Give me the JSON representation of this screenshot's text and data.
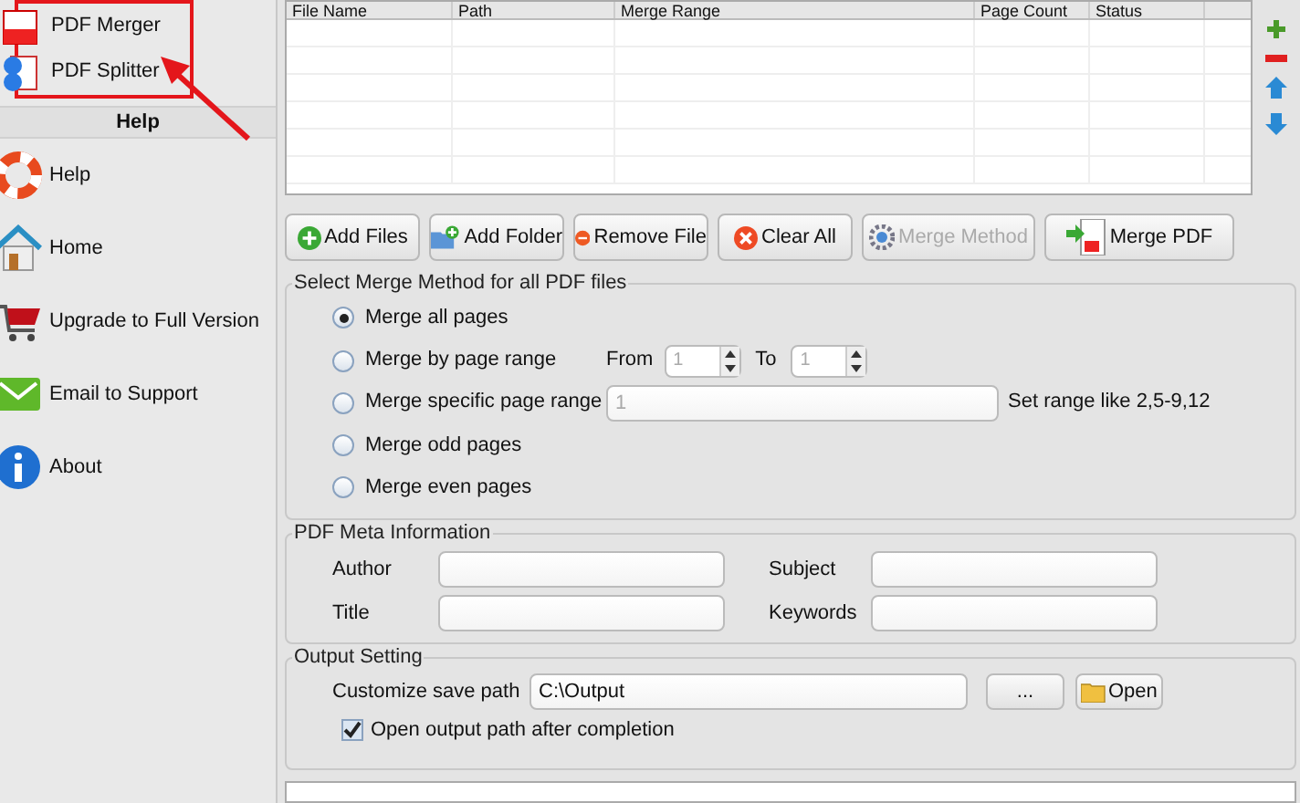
{
  "sidebar": {
    "tools": [
      {
        "label": "PDF Merger",
        "kind": "merge"
      },
      {
        "label": "PDF Splitter",
        "kind": "split"
      }
    ],
    "help_header": "Help",
    "help_items": [
      {
        "label": "Help",
        "kind": "lifebuoy"
      },
      {
        "label": "Home",
        "kind": "house"
      },
      {
        "label": "Upgrade to Full Version",
        "kind": "cart"
      },
      {
        "label": "Email to Support",
        "kind": "mail"
      },
      {
        "label": "About",
        "kind": "info"
      }
    ]
  },
  "table": {
    "columns": [
      "File Name",
      "Path",
      "Merge Range",
      "Page Count",
      "Status"
    ]
  },
  "buttons": [
    {
      "label": "Add Files",
      "kind": "add",
      "disabled": false
    },
    {
      "label": "Add Folder",
      "kind": "folder",
      "disabled": false
    },
    {
      "label": "Remove File",
      "kind": "remove",
      "disabled": false
    },
    {
      "label": "Clear All",
      "kind": "clear",
      "disabled": false
    },
    {
      "label": "Merge Method",
      "kind": "gear",
      "disabled": true
    },
    {
      "label": "Merge PDF",
      "kind": "pdf",
      "disabled": false
    }
  ],
  "merge_method": {
    "title": "Select Merge Method for all PDF files",
    "options": [
      {
        "kind": "plain",
        "label": "Merge all pages",
        "selected": true
      },
      {
        "kind": "range",
        "label": "Merge by page range",
        "selected": false,
        "from_label": "From",
        "from_value": "1",
        "to_label": "To",
        "to_value": "1"
      },
      {
        "kind": "specific",
        "label": "Merge specific page range",
        "selected": false,
        "value": "1",
        "hint": "Set range like 2,5-9,12"
      },
      {
        "kind": "plain",
        "label": "Merge odd pages",
        "selected": false
      },
      {
        "kind": "plain",
        "label": "Merge even pages",
        "selected": false
      }
    ]
  },
  "meta": {
    "title": "PDF Meta Information",
    "fields": [
      {
        "label": "Author"
      },
      {
        "label": "Subject"
      },
      {
        "label": "Title"
      },
      {
        "label": "Keywords"
      }
    ]
  },
  "output": {
    "title": "Output Setting",
    "path_label": "Customize save path",
    "path": "C:\\Output",
    "browse": "...",
    "open": "Open",
    "open_after": {
      "label": "Open output path after completion",
      "checked": true
    }
  }
}
